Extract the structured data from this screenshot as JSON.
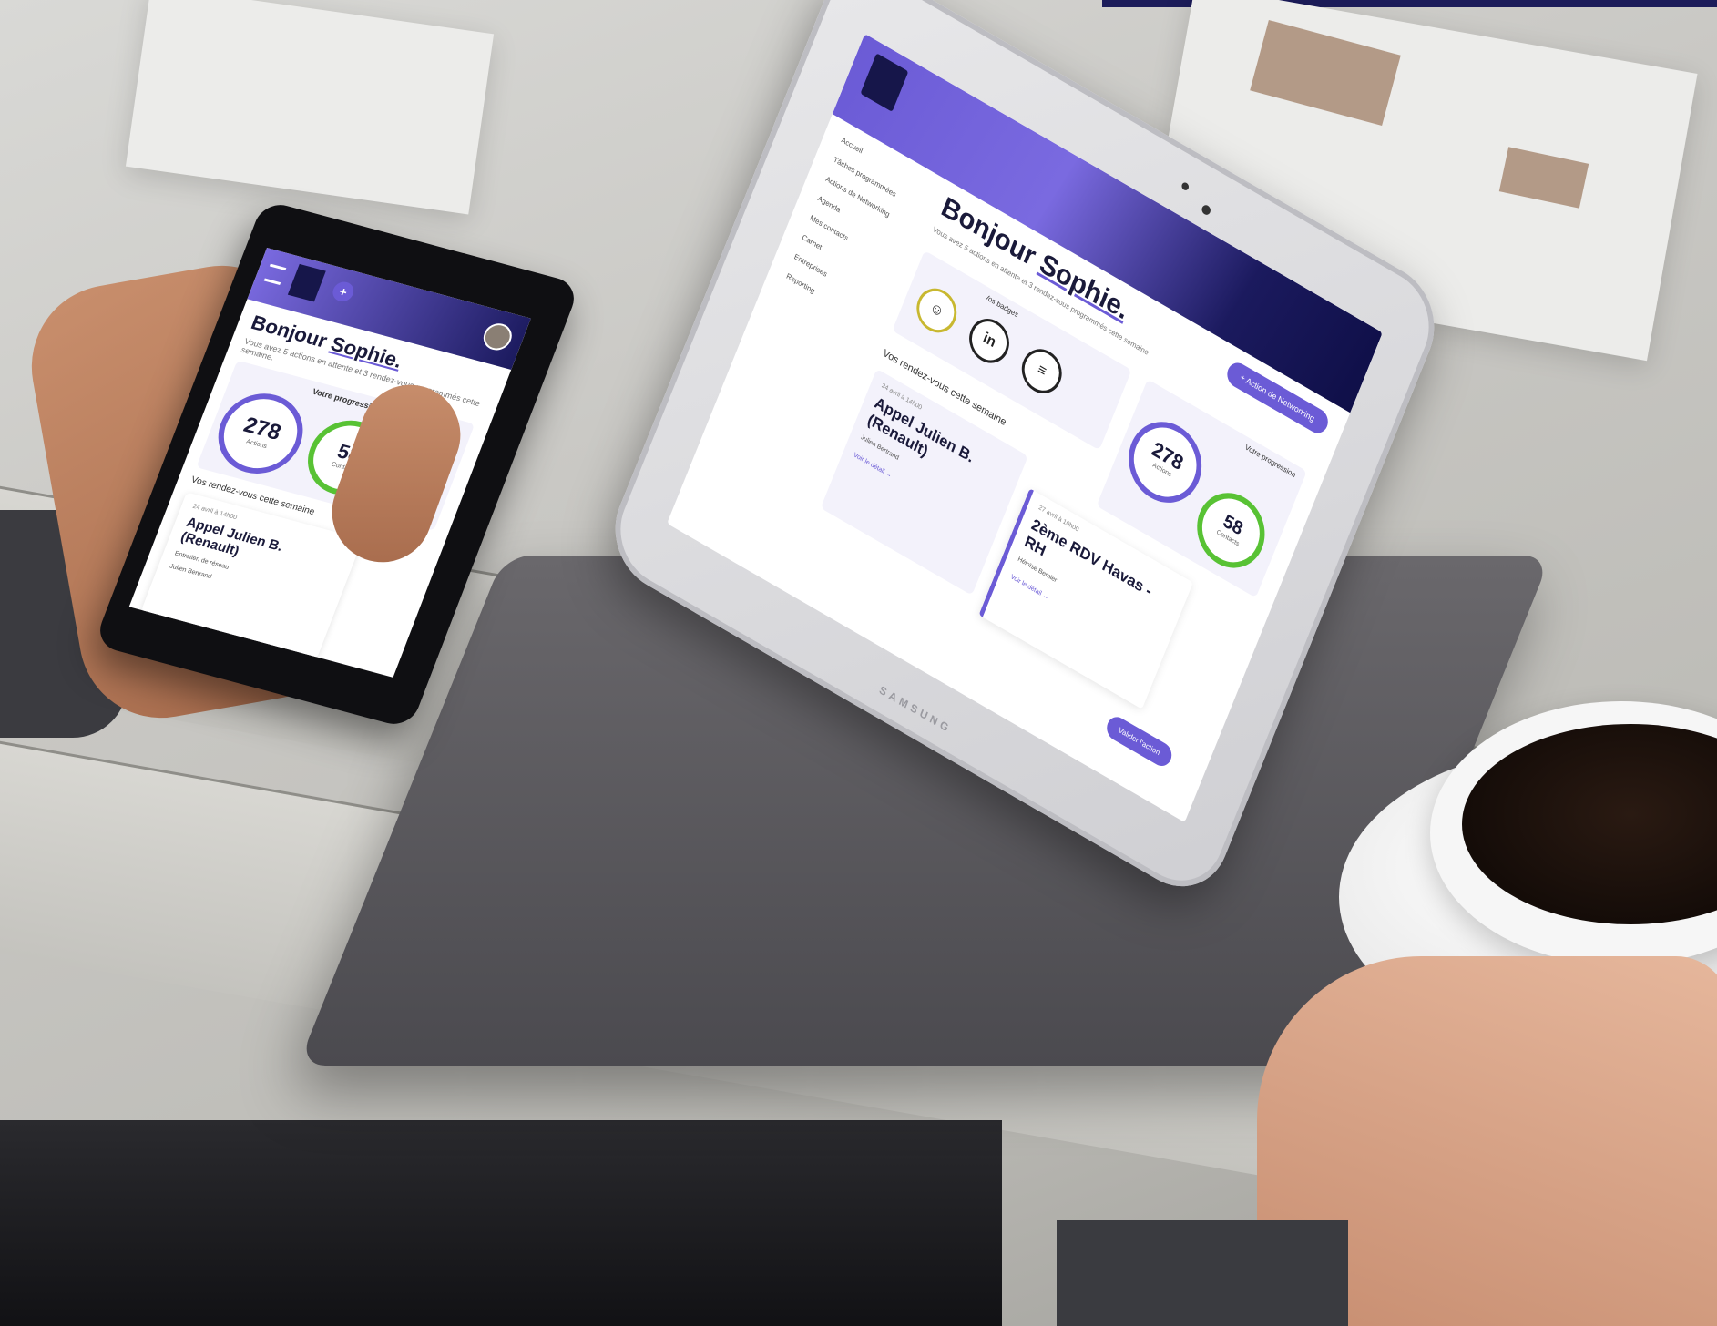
{
  "tablet": {
    "brand": "SAMSUNG",
    "nav_items": [
      "Accueil",
      "Tâches programmées",
      "Actions de Networking",
      "Agenda",
      "Mes contacts",
      "Carnet",
      "Entreprises",
      "Reporting"
    ],
    "greeting_prefix": "Bonjour",
    "greeting_name": "Sophie.",
    "subtitle": "Vous avez 5 actions en attente et 3 rendez-vous programmés cette semaine",
    "cta_button": "+ Action de Networking",
    "badges_title": "Vos badges",
    "badge_labels": [
      "",
      "in",
      "≡"
    ],
    "progress_title": "Votre progression",
    "ring_actions": {
      "value": "278",
      "label": "Actions"
    },
    "ring_contacts": {
      "value": "58",
      "label": "Contacts"
    },
    "appointments_title": "Vos rendez-vous cette semaine",
    "card1": {
      "date": "24 avril à 14h00",
      "title": "Appel Julien B. (Renault)",
      "person": "Julien Bertrand",
      "link": "Voir le détail →"
    },
    "card2": {
      "date": "27 avril à 10h00",
      "title": "2ème RDV Havas - RH",
      "person": "Héloïse Bernier",
      "link": "Voir le détail →"
    },
    "action_button": "Valider l'action"
  },
  "phone": {
    "greeting_prefix": "Bonjour",
    "greeting_name": "Sophie.",
    "subtitle": "Vous avez 5 actions en attente et 3 rendez-vous programmés cette semaine.",
    "progress_title": "Votre progression",
    "ring_actions": {
      "value": "278",
      "label": "Actions"
    },
    "ring_contacts": {
      "value": "58",
      "label": "Contacts"
    },
    "appointments_title": "Vos rendez-vous cette semaine",
    "card": {
      "date": "24 avril à 14h00",
      "title": "Appel Julien B. (Renault)",
      "subtitle": "Entretien de réseau",
      "person": "Julien Bertrand"
    }
  },
  "colors": {
    "accent": "#6b5bd6",
    "navy": "#1b1a5e",
    "ring_green": "#58c234"
  }
}
